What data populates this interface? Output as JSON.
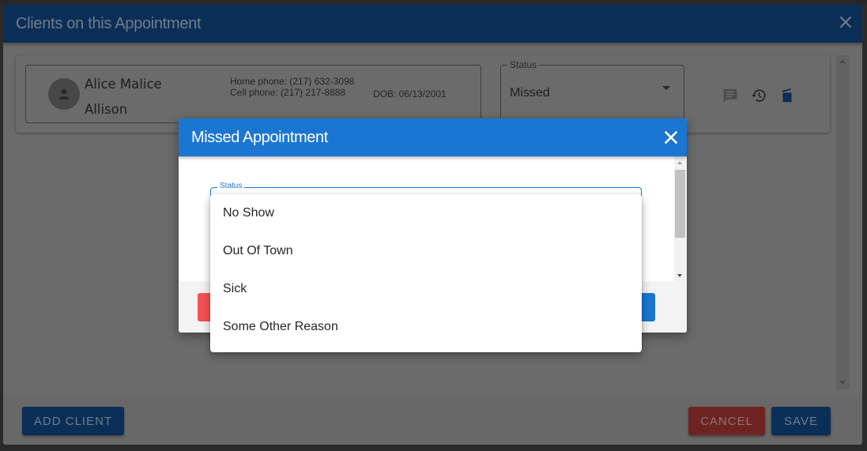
{
  "main_dialog": {
    "title": "Clients on this Appointment",
    "close_icon": "close-icon",
    "client": {
      "first_line": "Alice Malice",
      "second_line": "Allison",
      "avatar_icon": "person-icon",
      "home_phone": "Home phone: (217) 632-3098",
      "cell_phone": "Cell phone: (217) 217-8888",
      "dob": "DOB: 06/13/2001",
      "status_label": "Status",
      "status_value": "Missed",
      "icons": [
        "comment-icon",
        "history-icon",
        "delete-icon"
      ]
    },
    "footer": {
      "add_client_label": "Add Client",
      "cancel_label": "Cancel",
      "save_label": "Save"
    }
  },
  "missed_dialog": {
    "title": "Missed Appointment",
    "close_icon": "close-icon",
    "status_label": "Status",
    "options": [
      "No Show",
      "Out Of Town",
      "Sick",
      "Some Other Reason"
    ]
  },
  "colors": {
    "primary_blue": "#1b76d2",
    "dimmed_primary": "#0b2e57",
    "danger_red": "#f55252",
    "dimmed_danger": "#6e2323",
    "overlay_gray": "#6b6b6b"
  }
}
